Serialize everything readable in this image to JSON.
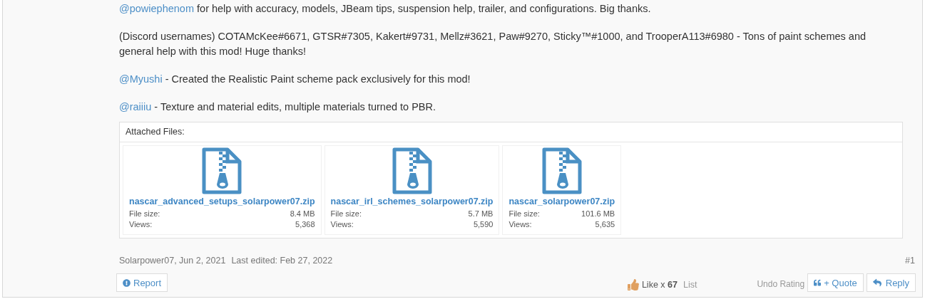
{
  "paragraphs": [
    {
      "mention": "@powiephenom",
      "text": " for help with accuracy, models, JBeam tips, suspension help, trailer, and configurations. Big thanks."
    },
    {
      "text": "(Discord usernames) COTAMcKee#6671, GTSR#7305, Kakert#9731, Mellz#3621, Paw#9270, Sticky™#1000, and TrooperA113#6980 - Tons of paint schemes and general help with this mod! Huge thanks!"
    },
    {
      "mention": "@Myushi",
      "text": " - Created the Realistic Paint scheme pack exclusively for this mod!"
    },
    {
      "mention": "@raiiiu",
      "text": " - Texture and material edits, multiple materials turned to PBR."
    }
  ],
  "attachments": {
    "heading": "Attached Files:",
    "files": [
      {
        "name": "nascar_advanced_setups_solarpower07.zip",
        "size_label": "File size:",
        "size": "8.4 MB",
        "views_label": "Views:",
        "views": "5,368"
      },
      {
        "name": "nascar_irl_schemes_solarpower07.zip",
        "size_label": "File size:",
        "size": "5.7 MB",
        "views_label": "Views:",
        "views": "5,590"
      },
      {
        "name": "nascar_solarpower07.zip",
        "size_label": "File size:",
        "size": "101.6 MB",
        "views_label": "Views:",
        "views": "5,635"
      }
    ]
  },
  "meta": {
    "author_date": "Solarpower07, Jun 2, 2021",
    "edited": "Last edited: Feb 27, 2022",
    "post_number": "#1"
  },
  "actions": {
    "report": "Report",
    "like_label": "Like x ",
    "like_count": "67",
    "list": "List",
    "undo_rating": "Undo Rating",
    "quote": "+ Quote",
    "reply": "Reply"
  }
}
